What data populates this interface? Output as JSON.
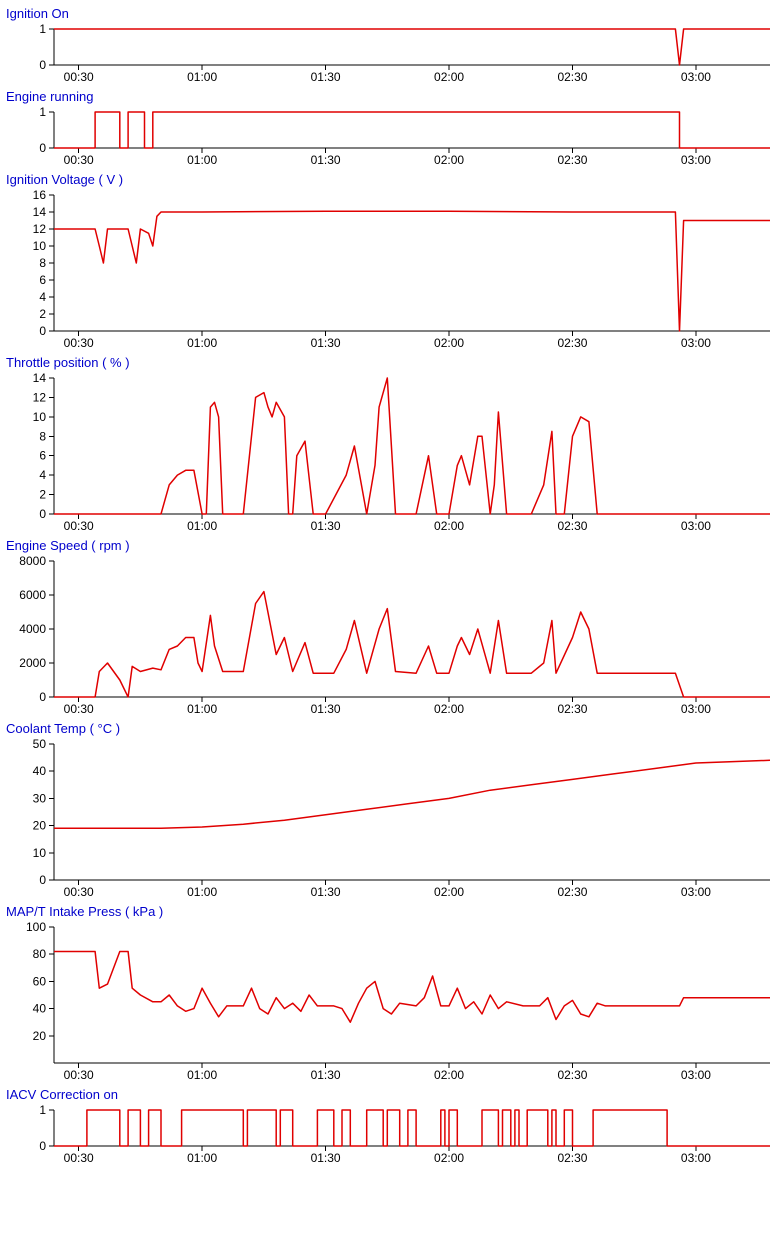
{
  "x_axis": {
    "min": 24,
    "max": 198,
    "ticks": [
      30,
      60,
      90,
      120,
      150,
      180
    ],
    "tick_labels": [
      "00:30",
      "01:00",
      "01:30",
      "02:00",
      "02:30",
      "03:00"
    ]
  },
  "chart_data": [
    {
      "title": "Ignition On",
      "type": "line",
      "height": 60,
      "y_min": 0,
      "y_max": 1,
      "y_ticks": [
        0,
        1
      ],
      "values": [
        [
          24,
          1
        ],
        [
          175,
          1
        ],
        [
          176,
          0
        ],
        [
          177,
          1
        ],
        [
          198,
          1
        ]
      ]
    },
    {
      "title": "Engine running",
      "type": "line",
      "height": 60,
      "y_min": 0,
      "y_max": 1,
      "y_ticks": [
        0,
        1
      ],
      "values": [
        [
          24,
          0
        ],
        [
          34,
          0
        ],
        [
          34,
          1
        ],
        [
          40,
          1
        ],
        [
          40,
          0
        ],
        [
          42,
          0
        ],
        [
          42,
          1
        ],
        [
          46,
          1
        ],
        [
          46,
          0
        ],
        [
          48,
          0
        ],
        [
          48,
          1
        ],
        [
          176,
          1
        ],
        [
          176,
          0
        ],
        [
          198,
          0
        ]
      ]
    },
    {
      "title": "Ignition Voltage ( V )",
      "type": "line",
      "height": 160,
      "y_min": 0,
      "y_max": 16,
      "y_ticks": [
        0,
        2,
        4,
        6,
        8,
        10,
        12,
        14,
        16
      ],
      "values": [
        [
          24,
          12
        ],
        [
          34,
          12
        ],
        [
          35,
          10
        ],
        [
          36,
          8
        ],
        [
          37,
          12
        ],
        [
          40,
          12
        ],
        [
          42,
          12
        ],
        [
          43,
          10
        ],
        [
          44,
          8
        ],
        [
          45,
          12
        ],
        [
          47,
          11.5
        ],
        [
          48,
          10
        ],
        [
          49,
          13.5
        ],
        [
          50,
          14
        ],
        [
          60,
          14
        ],
        [
          90,
          14.1
        ],
        [
          120,
          14.1
        ],
        [
          150,
          14
        ],
        [
          170,
          14
        ],
        [
          175,
          14
        ],
        [
          176,
          0
        ],
        [
          177,
          13
        ],
        [
          198,
          13
        ]
      ]
    },
    {
      "title": "Throttle position ( % )",
      "type": "line",
      "height": 160,
      "y_min": 0,
      "y_max": 14,
      "y_ticks": [
        0,
        2,
        4,
        6,
        8,
        10,
        12,
        14
      ],
      "values": [
        [
          24,
          0
        ],
        [
          50,
          0
        ],
        [
          52,
          3
        ],
        [
          54,
          4
        ],
        [
          56,
          4.5
        ],
        [
          58,
          4.5
        ],
        [
          60,
          0
        ],
        [
          61,
          0
        ],
        [
          62,
          11
        ],
        [
          63,
          11.5
        ],
        [
          64,
          10
        ],
        [
          65,
          0
        ],
        [
          70,
          0
        ],
        [
          73,
          12
        ],
        [
          75,
          12.5
        ],
        [
          76,
          11
        ],
        [
          77,
          10
        ],
        [
          78,
          11.5
        ],
        [
          80,
          10
        ],
        [
          81,
          0
        ],
        [
          82,
          0
        ],
        [
          83,
          6
        ],
        [
          85,
          7.5
        ],
        [
          87,
          0
        ],
        [
          90,
          0
        ],
        [
          95,
          4
        ],
        [
          97,
          7
        ],
        [
          100,
          0
        ],
        [
          102,
          5
        ],
        [
          103,
          11
        ],
        [
          105,
          14
        ],
        [
          107,
          0
        ],
        [
          112,
          0
        ],
        [
          115,
          6
        ],
        [
          117,
          0
        ],
        [
          120,
          0
        ],
        [
          122,
          5
        ],
        [
          123,
          6
        ],
        [
          125,
          3
        ],
        [
          127,
          8
        ],
        [
          128,
          8
        ],
        [
          130,
          0
        ],
        [
          131,
          3
        ],
        [
          132,
          10.5
        ],
        [
          134,
          0
        ],
        [
          140,
          0
        ],
        [
          143,
          3
        ],
        [
          145,
          8.5
        ],
        [
          146,
          0
        ],
        [
          148,
          0
        ],
        [
          150,
          8
        ],
        [
          152,
          10
        ],
        [
          154,
          9.5
        ],
        [
          156,
          0
        ],
        [
          160,
          0
        ],
        [
          175,
          0
        ],
        [
          198,
          0
        ]
      ]
    },
    {
      "title": "Engine Speed ( rpm )",
      "type": "line",
      "height": 160,
      "y_min": 0,
      "y_max": 8000,
      "y_ticks": [
        0,
        2000,
        4000,
        6000,
        8000
      ],
      "values": [
        [
          24,
          0
        ],
        [
          34,
          0
        ],
        [
          35,
          1500
        ],
        [
          37,
          2000
        ],
        [
          40,
          1000
        ],
        [
          42,
          0
        ],
        [
          43,
          1800
        ],
        [
          45,
          1500
        ],
        [
          48,
          1700
        ],
        [
          50,
          1600
        ],
        [
          52,
          2800
        ],
        [
          54,
          3000
        ],
        [
          56,
          3500
        ],
        [
          58,
          3500
        ],
        [
          59,
          2000
        ],
        [
          60,
          1500
        ],
        [
          62,
          4800
        ],
        [
          63,
          3000
        ],
        [
          65,
          1500
        ],
        [
          70,
          1500
        ],
        [
          73,
          5500
        ],
        [
          75,
          6200
        ],
        [
          78,
          2500
        ],
        [
          80,
          3500
        ],
        [
          82,
          1500
        ],
        [
          85,
          3200
        ],
        [
          87,
          1400
        ],
        [
          92,
          1400
        ],
        [
          95,
          2800
        ],
        [
          97,
          4500
        ],
        [
          100,
          1400
        ],
        [
          103,
          4000
        ],
        [
          105,
          5200
        ],
        [
          107,
          1500
        ],
        [
          112,
          1400
        ],
        [
          115,
          3000
        ],
        [
          117,
          1400
        ],
        [
          120,
          1400
        ],
        [
          122,
          3000
        ],
        [
          123,
          3500
        ],
        [
          125,
          2500
        ],
        [
          127,
          4000
        ],
        [
          130,
          1400
        ],
        [
          132,
          4500
        ],
        [
          134,
          1400
        ],
        [
          140,
          1400
        ],
        [
          143,
          2000
        ],
        [
          145,
          4500
        ],
        [
          146,
          1400
        ],
        [
          150,
          3500
        ],
        [
          152,
          5000
        ],
        [
          154,
          4000
        ],
        [
          156,
          1400
        ],
        [
          160,
          1400
        ],
        [
          175,
          1400
        ],
        [
          177,
          0
        ],
        [
          198,
          0
        ]
      ]
    },
    {
      "title": "Coolant Temp ( °C )",
      "type": "line",
      "height": 160,
      "y_min": 0,
      "y_max": 50,
      "y_ticks": [
        0,
        10,
        20,
        30,
        40,
        50
      ],
      "values": [
        [
          24,
          19
        ],
        [
          50,
          19
        ],
        [
          60,
          19.5
        ],
        [
          70,
          20.5
        ],
        [
          80,
          22
        ],
        [
          90,
          24
        ],
        [
          100,
          26
        ],
        [
          110,
          28
        ],
        [
          120,
          30
        ],
        [
          130,
          33
        ],
        [
          140,
          35
        ],
        [
          150,
          37
        ],
        [
          160,
          39
        ],
        [
          170,
          41
        ],
        [
          180,
          43
        ],
        [
          198,
          44
        ]
      ]
    },
    {
      "title": "MAP/T Intake Press ( kPa )",
      "type": "line",
      "height": 160,
      "y_min": 0,
      "y_max": 100,
      "y_ticks": [
        20,
        40,
        60,
        80,
        100
      ],
      "values": [
        [
          24,
          82
        ],
        [
          34,
          82
        ],
        [
          35,
          55
        ],
        [
          37,
          58
        ],
        [
          40,
          82
        ],
        [
          42,
          82
        ],
        [
          43,
          55
        ],
        [
          45,
          50
        ],
        [
          48,
          45
        ],
        [
          50,
          45
        ],
        [
          52,
          50
        ],
        [
          54,
          42
        ],
        [
          56,
          38
        ],
        [
          58,
          40
        ],
        [
          60,
          55
        ],
        [
          62,
          44
        ],
        [
          64,
          34
        ],
        [
          66,
          42
        ],
        [
          70,
          42
        ],
        [
          72,
          55
        ],
        [
          74,
          40
        ],
        [
          76,
          36
        ],
        [
          78,
          48
        ],
        [
          80,
          40
        ],
        [
          82,
          44
        ],
        [
          84,
          38
        ],
        [
          86,
          50
        ],
        [
          88,
          42
        ],
        [
          92,
          42
        ],
        [
          94,
          40
        ],
        [
          96,
          30
        ],
        [
          98,
          44
        ],
        [
          100,
          55
        ],
        [
          102,
          60
        ],
        [
          104,
          40
        ],
        [
          106,
          36
        ],
        [
          108,
          44
        ],
        [
          112,
          42
        ],
        [
          114,
          48
        ],
        [
          116,
          64
        ],
        [
          118,
          42
        ],
        [
          120,
          42
        ],
        [
          122,
          55
        ],
        [
          124,
          40
        ],
        [
          126,
          45
        ],
        [
          128,
          36
        ],
        [
          130,
          50
        ],
        [
          132,
          40
        ],
        [
          134,
          45
        ],
        [
          138,
          42
        ],
        [
          142,
          42
        ],
        [
          144,
          48
        ],
        [
          146,
          32
        ],
        [
          148,
          42
        ],
        [
          150,
          46
        ],
        [
          152,
          36
        ],
        [
          154,
          34
        ],
        [
          156,
          44
        ],
        [
          158,
          42
        ],
        [
          170,
          42
        ],
        [
          176,
          42
        ],
        [
          177,
          48
        ],
        [
          198,
          48
        ]
      ]
    },
    {
      "title": "IACV Correction on",
      "type": "line",
      "height": 60,
      "y_min": 0,
      "y_max": 1,
      "y_ticks": [
        0,
        1
      ],
      "values": [
        [
          24,
          0
        ],
        [
          32,
          0
        ],
        [
          32,
          1
        ],
        [
          40,
          1
        ],
        [
          40,
          0
        ],
        [
          42,
          0
        ],
        [
          42,
          1
        ],
        [
          45,
          1
        ],
        [
          45,
          0
        ],
        [
          47,
          0
        ],
        [
          47,
          1
        ],
        [
          50,
          1
        ],
        [
          50,
          0
        ],
        [
          55,
          0
        ],
        [
          55,
          1
        ],
        [
          70,
          1
        ],
        [
          70,
          0
        ],
        [
          71,
          0
        ],
        [
          71,
          1
        ],
        [
          78,
          1
        ],
        [
          78,
          0
        ],
        [
          79,
          0
        ],
        [
          79,
          1
        ],
        [
          82,
          1
        ],
        [
          82,
          0
        ],
        [
          88,
          0
        ],
        [
          88,
          1
        ],
        [
          92,
          1
        ],
        [
          92,
          0
        ],
        [
          94,
          0
        ],
        [
          94,
          1
        ],
        [
          96,
          1
        ],
        [
          96,
          0
        ],
        [
          100,
          0
        ],
        [
          100,
          1
        ],
        [
          104,
          1
        ],
        [
          104,
          0
        ],
        [
          105,
          0
        ],
        [
          105,
          1
        ],
        [
          108,
          1
        ],
        [
          108,
          0
        ],
        [
          110,
          0
        ],
        [
          110,
          1
        ],
        [
          112,
          1
        ],
        [
          112,
          0
        ],
        [
          118,
          0
        ],
        [
          118,
          1
        ],
        [
          119,
          1
        ],
        [
          119,
          0
        ],
        [
          120,
          0
        ],
        [
          120,
          1
        ],
        [
          122,
          1
        ],
        [
          122,
          0
        ],
        [
          128,
          0
        ],
        [
          128,
          1
        ],
        [
          132,
          1
        ],
        [
          132,
          0
        ],
        [
          133,
          0
        ],
        [
          133,
          1
        ],
        [
          135,
          1
        ],
        [
          135,
          0
        ],
        [
          136,
          0
        ],
        [
          136,
          1
        ],
        [
          137,
          1
        ],
        [
          137,
          0
        ],
        [
          139,
          0
        ],
        [
          139,
          1
        ],
        [
          144,
          1
        ],
        [
          144,
          0
        ],
        [
          145,
          0
        ],
        [
          145,
          1
        ],
        [
          146,
          1
        ],
        [
          146,
          0
        ],
        [
          148,
          0
        ],
        [
          148,
          1
        ],
        [
          150,
          1
        ],
        [
          150,
          0
        ],
        [
          155,
          0
        ],
        [
          155,
          1
        ],
        [
          173,
          1
        ],
        [
          173,
          0
        ],
        [
          198,
          0
        ]
      ]
    }
  ]
}
